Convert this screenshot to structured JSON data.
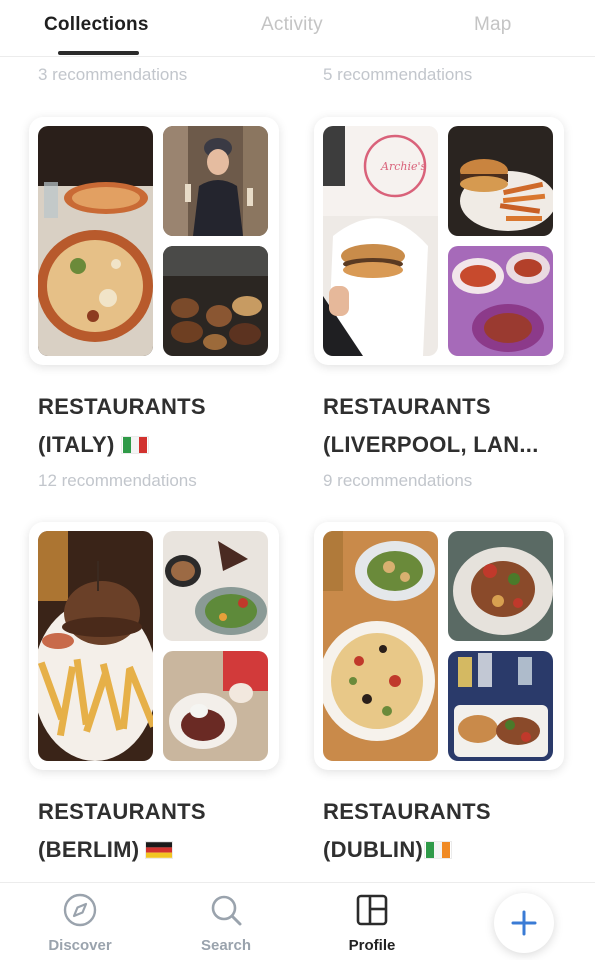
{
  "tabs": [
    {
      "label": "Collections",
      "active": true
    },
    {
      "label": "Activity",
      "active": false
    },
    {
      "label": "Map",
      "active": false
    }
  ],
  "top_counts": [
    "3 recommendations",
    "5 recommendations"
  ],
  "collections": [
    {
      "title_line1": "RESTAURANTS",
      "title_line2": "(ITALY)",
      "flag": "italy-flag",
      "count": "12 recommendations"
    },
    {
      "title_line1": "RESTAURANTS",
      "title_line2": "(LIVERPOOL, LAN...",
      "flag": "",
      "count": "9 recommendations"
    },
    {
      "title_line1": "RESTAURANTS",
      "title_line2": "(BERLIM)",
      "flag": "germany-flag",
      "count": ""
    },
    {
      "title_line1": "RESTAURANTS",
      "title_line2": "(DUBLIN)",
      "flag": "ireland-flag",
      "count": ""
    }
  ],
  "bottom_nav": [
    {
      "label": "Discover",
      "icon": "compass-icon",
      "active": false
    },
    {
      "label": "Search",
      "icon": "search-icon",
      "active": false
    },
    {
      "label": "Profile",
      "icon": "layout-icon",
      "active": true
    }
  ],
  "fab": {
    "icon": "plus-icon"
  },
  "colors": {
    "accent": "#3a7bd5",
    "muted": "#c2c6cc",
    "text": "#2f2f2f"
  }
}
